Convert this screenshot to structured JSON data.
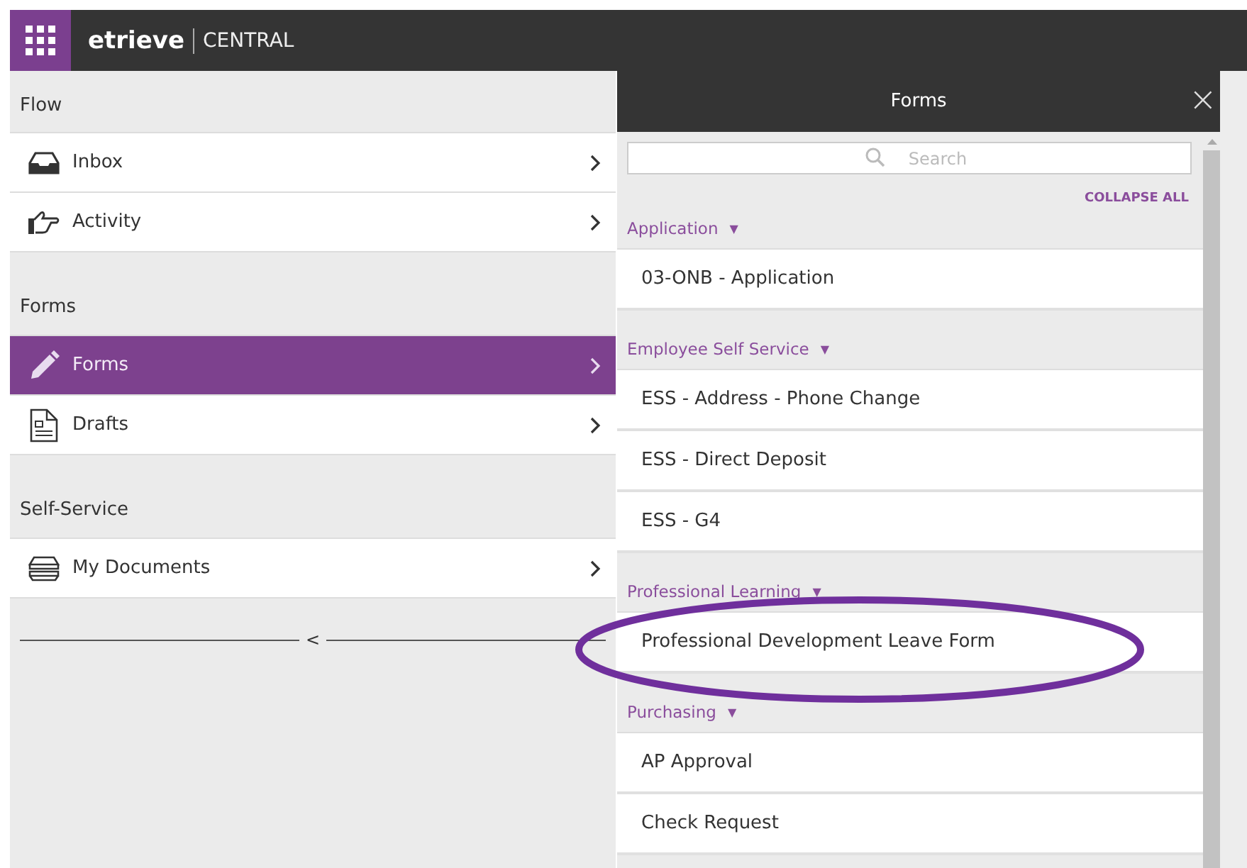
{
  "header": {
    "brand": "etrieve",
    "product": "CENTRAL"
  },
  "nav": [
    {
      "heading": "Flow",
      "items": [
        {
          "label": "Inbox",
          "selected": false
        },
        {
          "label": "Activity",
          "selected": false
        }
      ]
    },
    {
      "heading": "Forms",
      "items": [
        {
          "label": "Forms",
          "selected": true
        },
        {
          "label": "Drafts",
          "selected": false
        }
      ]
    },
    {
      "heading": "Self-Service",
      "items": [
        {
          "label": "My Documents",
          "selected": false
        }
      ]
    }
  ],
  "collapse_handle": "<",
  "forms_panel": {
    "title": "Forms",
    "close": "×",
    "search": {
      "placeholder": "Search"
    },
    "collapse_all": "COLLAPSE ALL",
    "groups": [
      {
        "name": "Application",
        "toggle": "▼",
        "expanded": true,
        "items": [
          {
            "label": "03-ONB - Application",
            "circled": false
          }
        ]
      },
      {
        "name": "Employee Self Service",
        "toggle": "▼",
        "expanded": true,
        "items": [
          {
            "label": "ESS - Address - Phone Change",
            "circled": false
          },
          {
            "label": "ESS - Direct Deposit",
            "circled": false
          },
          {
            "label": "ESS - G4",
            "circled": false
          }
        ]
      },
      {
        "name": "Professional Learning",
        "toggle": "▼",
        "expanded": true,
        "items": [
          {
            "label": "Professional Development Leave Form",
            "circled": true
          }
        ]
      },
      {
        "name": "Purchasing",
        "toggle": "▼",
        "expanded": true,
        "items": [
          {
            "label": "AP Approval",
            "circled": false
          },
          {
            "label": "Check Request",
            "circled": false
          }
        ]
      }
    ]
  }
}
